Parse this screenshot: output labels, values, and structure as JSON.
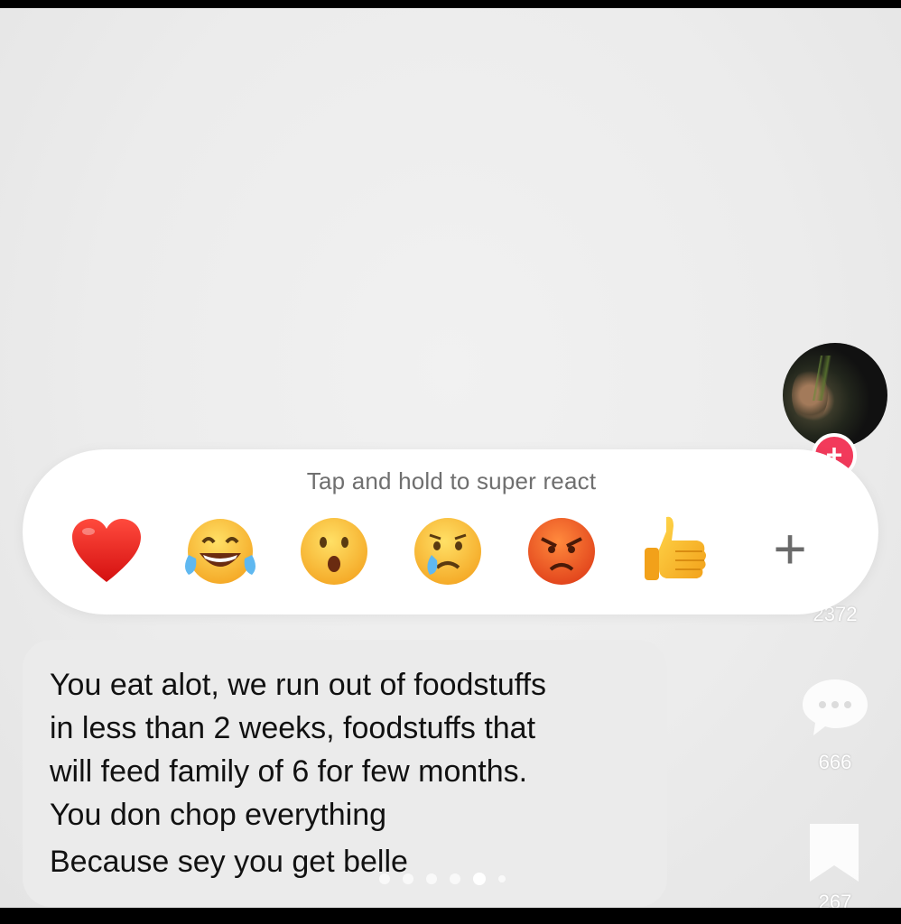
{
  "reaction_bar": {
    "hint": "Tap and hold to super react",
    "reactions": [
      {
        "icon": "red-heart-icon"
      },
      {
        "icon": "tears-of-joy-icon"
      },
      {
        "icon": "surprised-face-icon"
      },
      {
        "icon": "crying-face-icon"
      },
      {
        "icon": "angry-face-icon"
      },
      {
        "icon": "thumbs-up-icon"
      }
    ],
    "more_icon": "plus-icon",
    "more_label": "+"
  },
  "message": {
    "lines": [
      "You eat alot, we run out of foodstuffs",
      "in less than 2 weeks, foodstuffs that",
      "will feed family of 6 for few months.",
      "You don chop everything",
      "Because sey you get belle"
    ]
  },
  "right_rail": {
    "follow_label": "+",
    "likes": "2372",
    "comments": "666",
    "saves": "267"
  },
  "carousel": {
    "total": 6,
    "active_index": 4
  },
  "colors": {
    "background": "#ececec",
    "reaction_bar": "#ffffff",
    "bubble": "#ebebeb",
    "follow_badge": "#f23a5b"
  }
}
